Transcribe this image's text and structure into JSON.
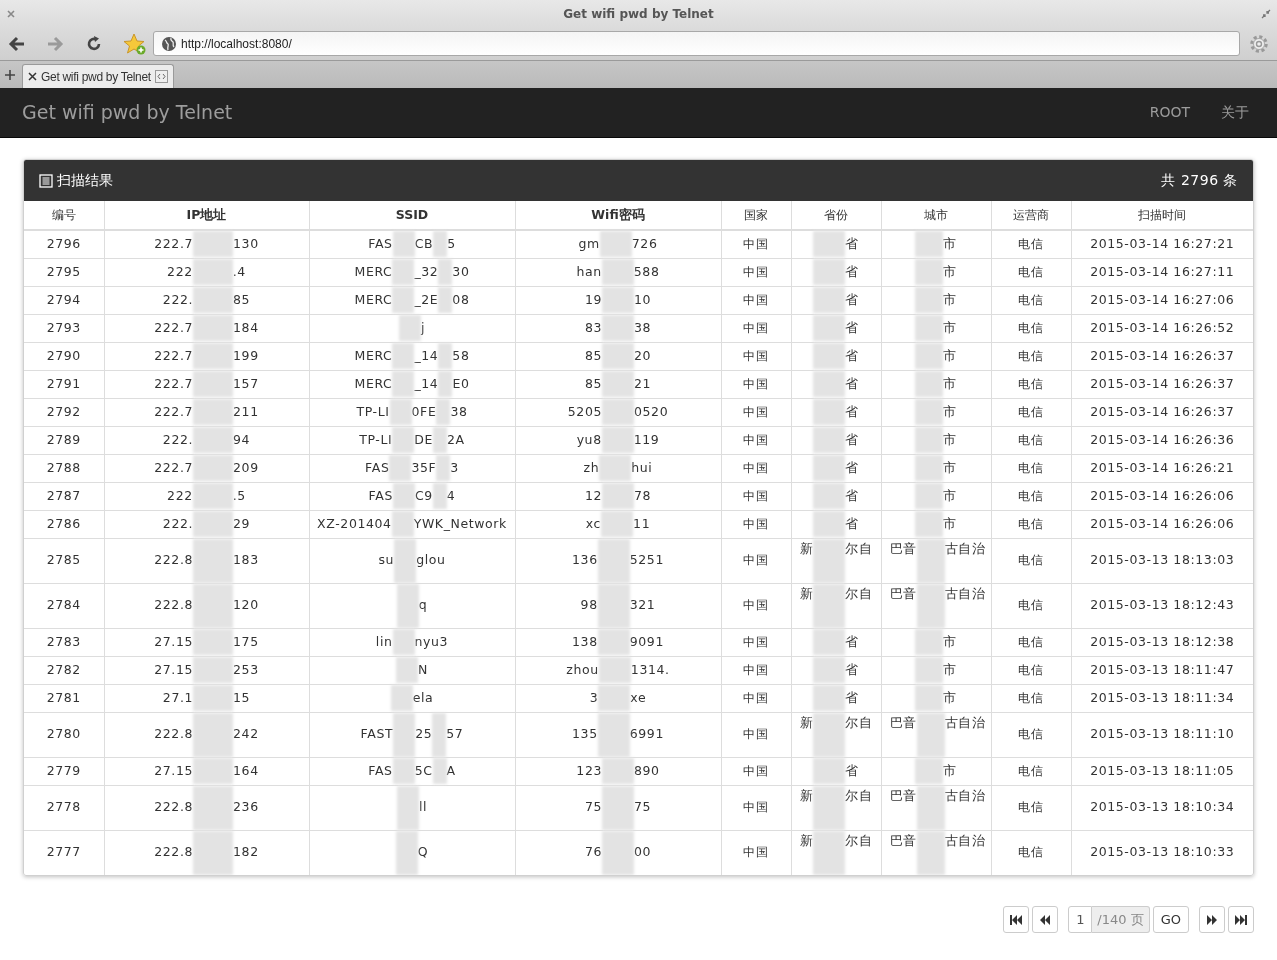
{
  "browser": {
    "title": "Get wifi pwd by Telnet",
    "nav": [
      {
        "kind": "back",
        "disabled": false
      },
      {
        "kind": "forward",
        "disabled": true
      },
      {
        "kind": "reload",
        "disabled": false
      }
    ],
    "url": "http://localhost:8080/",
    "tabs": [
      {
        "label": "Get wifi pwd by Telnet",
        "selected": true
      }
    ]
  },
  "navbar": {
    "brand": "Get wifi pwd by Telnet",
    "links": [
      "ROOT",
      "关于"
    ]
  },
  "panel": {
    "title": "扫描结果",
    "count": "共 2796 条",
    "columns": [
      "编号",
      "IP地址",
      "SSID",
      "Wifi密码",
      "国家",
      "省份",
      "城市",
      "运营商",
      "扫描时间"
    ],
    "rows": [
      {
        "id": "2796",
        "ip": {
          "before": "222.7",
          "after": [
            "130"
          ]
        },
        "ssid": {
          "before": "FAS",
          "after": [
            "CB",
            "5"
          ]
        },
        "pwd": {
          "before": "gm",
          "after": [
            "726"
          ]
        },
        "country": "中国",
        "province": {
          "after": [
            "省"
          ]
        },
        "city": {
          "after": [
            "市"
          ]
        },
        "isp": "电信",
        "time": "2015-03-14 16:27:21"
      },
      {
        "id": "2795",
        "ip": {
          "before": "222",
          "after": [
            ".4"
          ]
        },
        "ssid": {
          "before": "MERC",
          "after": [
            "_32",
            "30"
          ]
        },
        "pwd": {
          "before": "han",
          "after": [
            "588"
          ]
        },
        "country": "中国",
        "province": {
          "after": [
            "省"
          ]
        },
        "city": {
          "after": [
            "市"
          ]
        },
        "isp": "电信",
        "time": "2015-03-14 16:27:11"
      },
      {
        "id": "2794",
        "ip": {
          "before": "222.",
          "after": [
            "85"
          ]
        },
        "ssid": {
          "before": "MERC",
          "after": [
            "_2E",
            "08"
          ]
        },
        "pwd": {
          "before": "19",
          "after": [
            "10"
          ]
        },
        "country": "中国",
        "province": {
          "after": [
            "省"
          ]
        },
        "city": {
          "after": [
            "市"
          ]
        },
        "isp": "电信",
        "time": "2015-03-14 16:27:06"
      },
      {
        "id": "2793",
        "ip": {
          "before": "222.7",
          "after": [
            "184"
          ]
        },
        "ssid": {
          "after": [
            "j"
          ]
        },
        "pwd": {
          "before": "83",
          "after": [
            "38"
          ]
        },
        "country": "中国",
        "province": {
          "after": [
            "省"
          ]
        },
        "city": {
          "after": [
            "市"
          ]
        },
        "isp": "电信",
        "time": "2015-03-14 16:26:52"
      },
      {
        "id": "2790",
        "ip": {
          "before": "222.7",
          "after": [
            "199"
          ]
        },
        "ssid": {
          "before": "MERC",
          "after": [
            "_14",
            "58"
          ]
        },
        "pwd": {
          "before": "85",
          "after": [
            "20"
          ]
        },
        "country": "中国",
        "province": {
          "after": [
            "省"
          ]
        },
        "city": {
          "after": [
            "市"
          ]
        },
        "isp": "电信",
        "time": "2015-03-14 16:26:37"
      },
      {
        "id": "2791",
        "ip": {
          "before": "222.7",
          "after": [
            "157"
          ]
        },
        "ssid": {
          "before": "MERC",
          "after": [
            "_14",
            "E0"
          ]
        },
        "pwd": {
          "before": "85",
          "after": [
            "21"
          ]
        },
        "country": "中国",
        "province": {
          "after": [
            "省"
          ]
        },
        "city": {
          "after": [
            "市"
          ]
        },
        "isp": "电信",
        "time": "2015-03-14 16:26:37"
      },
      {
        "id": "2792",
        "ip": {
          "before": "222.7",
          "after": [
            "211"
          ]
        },
        "ssid": {
          "before": "TP-LI",
          "after": [
            "0FE",
            "38"
          ]
        },
        "pwd": {
          "before": "5205",
          "after": [
            "0520"
          ]
        },
        "country": "中国",
        "province": {
          "after": [
            "省"
          ]
        },
        "city": {
          "after": [
            "市"
          ]
        },
        "isp": "电信",
        "time": "2015-03-14 16:26:37"
      },
      {
        "id": "2789",
        "ip": {
          "before": "222.",
          "after": [
            "94"
          ]
        },
        "ssid": {
          "before": "TP-LI",
          "after": [
            "DE",
            "2A"
          ]
        },
        "pwd": {
          "before": "yu8",
          "after": [
            "119"
          ]
        },
        "country": "中国",
        "province": {
          "after": [
            "省"
          ]
        },
        "city": {
          "after": [
            "市"
          ]
        },
        "isp": "电信",
        "time": "2015-03-14 16:26:36"
      },
      {
        "id": "2788",
        "ip": {
          "before": "222.7",
          "after": [
            "209"
          ]
        },
        "ssid": {
          "before": "FAS",
          "after": [
            "35F",
            "3"
          ]
        },
        "pwd": {
          "before": "zh",
          "after": [
            "hui"
          ]
        },
        "country": "中国",
        "province": {
          "after": [
            "省"
          ]
        },
        "city": {
          "after": [
            "市"
          ]
        },
        "isp": "电信",
        "time": "2015-03-14 16:26:21"
      },
      {
        "id": "2787",
        "ip": {
          "before": "222",
          "after": [
            ".5"
          ]
        },
        "ssid": {
          "before": "FAS",
          "after": [
            "C9",
            "4"
          ]
        },
        "pwd": {
          "before": "12",
          "after": [
            "78"
          ]
        },
        "country": "中国",
        "province": {
          "after": [
            "省"
          ]
        },
        "city": {
          "after": [
            "市"
          ]
        },
        "isp": "电信",
        "time": "2015-03-14 16:26:06"
      },
      {
        "id": "2786",
        "ip": {
          "before": "222.",
          "after": [
            "29"
          ]
        },
        "ssid": {
          "before": "XZ-201404",
          "after": [
            "YWK_Network"
          ]
        },
        "pwd": {
          "before": "xc",
          "after": [
            "11"
          ]
        },
        "country": "中国",
        "province": {
          "after": [
            "省"
          ]
        },
        "city": {
          "after": [
            "市"
          ]
        },
        "isp": "电信",
        "time": "2015-03-14 16:26:06"
      },
      {
        "id": "2785",
        "ip": {
          "before": "222.8",
          "after": [
            "183"
          ]
        },
        "ssid": {
          "before": "su",
          "after": [
            "glou"
          ]
        },
        "pwd": {
          "before": "136",
          "after": [
            "5251"
          ]
        },
        "country": "中国",
        "province": {
          "before": "新",
          "after": [
            "尔自"
          ]
        },
        "city": {
          "before": "巴音",
          "after": [
            "古自治"
          ]
        },
        "isp": "电信",
        "time": "2015-03-13 18:13:03"
      },
      {
        "id": "2784",
        "ip": {
          "before": "222.8",
          "after": [
            "120"
          ]
        },
        "ssid": {
          "after": [
            "q"
          ]
        },
        "pwd": {
          "before": "98",
          "after": [
            "321"
          ]
        },
        "country": "中国",
        "province": {
          "before": "新",
          "after": [
            "尔自"
          ]
        },
        "city": {
          "before": "巴音",
          "after": [
            "古自治"
          ]
        },
        "isp": "电信",
        "time": "2015-03-13 18:12:43"
      },
      {
        "id": "2783",
        "ip": {
          "before": "27.15",
          "after": [
            "175"
          ]
        },
        "ssid": {
          "before": "lin",
          "after": [
            "nyu3"
          ]
        },
        "pwd": {
          "before": "138",
          "after": [
            "9091"
          ]
        },
        "country": "中国",
        "province": {
          "after": [
            "省"
          ]
        },
        "city": {
          "after": [
            "市"
          ]
        },
        "isp": "电信",
        "time": "2015-03-13 18:12:38"
      },
      {
        "id": "2782",
        "ip": {
          "before": "27.15",
          "after": [
            "253"
          ]
        },
        "ssid": {
          "after": [
            "N"
          ]
        },
        "pwd": {
          "before": "zhou",
          "after": [
            "1314."
          ]
        },
        "country": "中国",
        "province": {
          "after": [
            "省"
          ]
        },
        "city": {
          "after": [
            "市"
          ]
        },
        "isp": "电信",
        "time": "2015-03-13 18:11:47"
      },
      {
        "id": "2781",
        "ip": {
          "before": "27.1",
          "after": [
            "15"
          ]
        },
        "ssid": {
          "after": [
            "ela"
          ]
        },
        "pwd": {
          "before": "3",
          "after": [
            "xe"
          ]
        },
        "country": "中国",
        "province": {
          "after": [
            "省"
          ]
        },
        "city": {
          "after": [
            "市"
          ]
        },
        "isp": "电信",
        "time": "2015-03-13 18:11:34"
      },
      {
        "id": "2780",
        "ip": {
          "before": "222.8",
          "after": [
            "242"
          ]
        },
        "ssid": {
          "before": "FAST",
          "after": [
            "25",
            "57"
          ]
        },
        "pwd": {
          "before": "135",
          "after": [
            "6991"
          ]
        },
        "country": "中国",
        "province": {
          "before": "新",
          "after": [
            "尔自"
          ]
        },
        "city": {
          "before": "巴音",
          "after": [
            "古自治"
          ]
        },
        "isp": "电信",
        "time": "2015-03-13 18:11:10"
      },
      {
        "id": "2779",
        "ip": {
          "before": "27.15",
          "after": [
            "164"
          ]
        },
        "ssid": {
          "before": "FAS",
          "after": [
            "5C",
            "A"
          ]
        },
        "pwd": {
          "before": "123",
          "after": [
            "890"
          ]
        },
        "country": "中国",
        "province": {
          "after": [
            "省"
          ]
        },
        "city": {
          "after": [
            "市"
          ]
        },
        "isp": "电信",
        "time": "2015-03-13 18:11:05"
      },
      {
        "id": "2778",
        "ip": {
          "before": "222.8",
          "after": [
            "236"
          ]
        },
        "ssid": {
          "after": [
            "ll"
          ]
        },
        "pwd": {
          "before": "75",
          "after": [
            "75"
          ]
        },
        "country": "中国",
        "province": {
          "before": "新",
          "after": [
            "尔自"
          ]
        },
        "city": {
          "before": "巴音",
          "after": [
            "古自治"
          ]
        },
        "isp": "电信",
        "time": "2015-03-13 18:10:34"
      },
      {
        "id": "2777",
        "ip": {
          "before": "222.8",
          "after": [
            "182"
          ]
        },
        "ssid": {
          "after": [
            "Q"
          ]
        },
        "pwd": {
          "before": "76",
          "after": [
            "00"
          ]
        },
        "country": "中国",
        "province": {
          "before": "新",
          "after": [
            "尔自"
          ]
        },
        "city": {
          "before": "巴音",
          "after": [
            "古自治"
          ]
        },
        "isp": "电信",
        "time": "2015-03-13 18:10:33"
      }
    ]
  },
  "pagination": {
    "page": "1",
    "total": "/140 页",
    "go": "GO"
  }
}
